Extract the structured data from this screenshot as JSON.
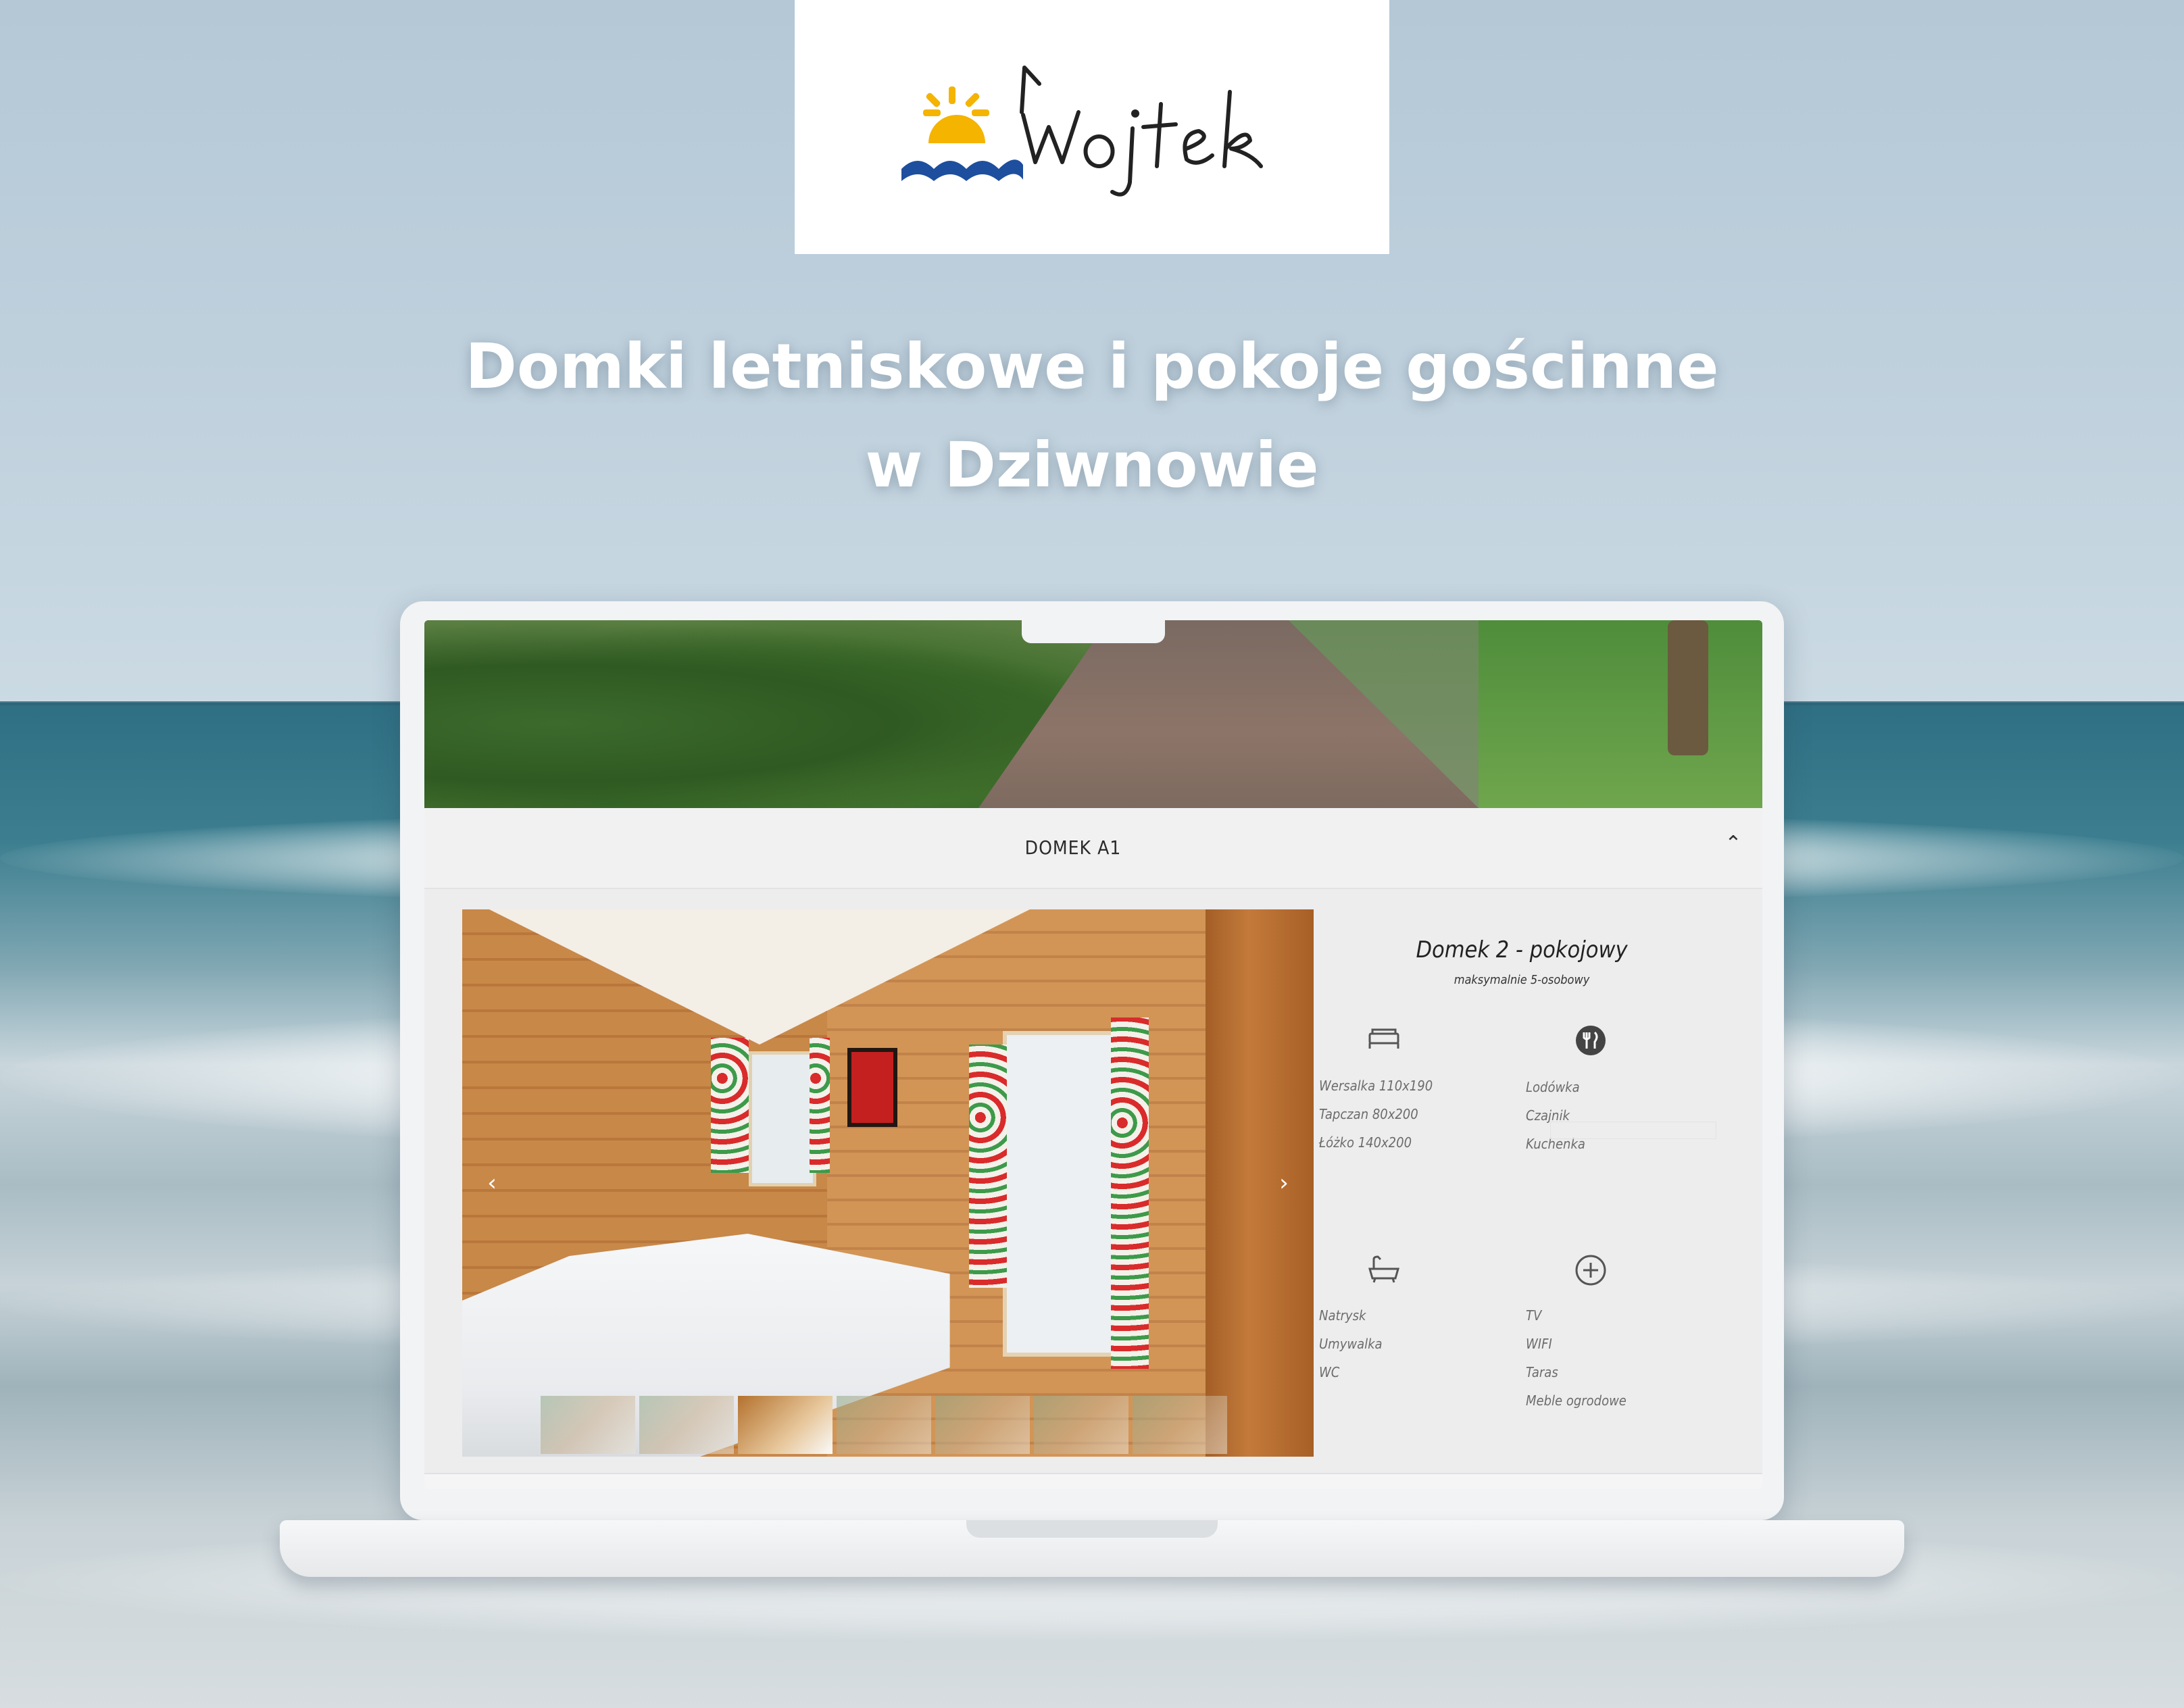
{
  "brand": {
    "logo_text": "Wojtek",
    "colors": {
      "sun": "#f4b400",
      "wave": "#1e4e9e",
      "background_box": "#ffffff"
    }
  },
  "headline": {
    "line1": "Domki letniskowe i pokoje gościnne",
    "line2": "w Dziwnowie"
  },
  "site": {
    "accordion": {
      "title": "DOMEK A1",
      "toggle_icon": "chevron-up-icon"
    },
    "gallery": {
      "prev_icon": "chevron-left-icon",
      "next_icon": "chevron-right-icon",
      "thumb_count": 7,
      "active_thumb": 3
    },
    "details": {
      "title": "Domek 2 - pokojowy",
      "subtitle": "maksymalnie 5-osobowy",
      "beds": {
        "icon": "bed-icon",
        "items": [
          "Wersalka 110x190",
          "Tapczan 80x200",
          "Łóżko 140x200"
        ]
      },
      "kitchen": {
        "icon": "cutlery-icon",
        "items": [
          "Lodówka",
          "Czajnik",
          "Kuchenka"
        ]
      },
      "bathroom": {
        "icon": "bathtub-icon",
        "items": [
          "Natrysk",
          "Umywalka",
          "WC"
        ]
      },
      "extras": {
        "icon": "plus-circle-icon",
        "items": [
          "TV",
          "WIFI",
          "Taras",
          "Meble ogrodowe"
        ]
      }
    }
  }
}
